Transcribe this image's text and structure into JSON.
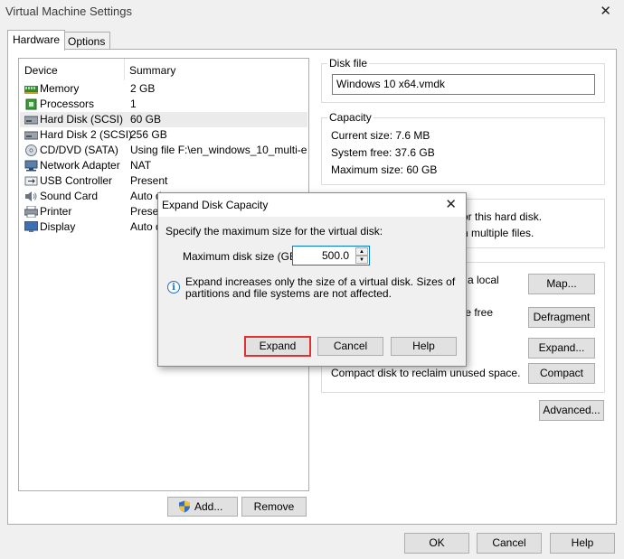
{
  "window": {
    "title": "Virtual Machine Settings",
    "close_glyph": "✕"
  },
  "tabs": [
    {
      "label": "Hardware"
    },
    {
      "label": "Options"
    }
  ],
  "device_list": {
    "headers": {
      "device": "Device",
      "summary": "Summary"
    },
    "rows": [
      {
        "name": "Memory",
        "summary": "2 GB",
        "icon": "memory-icon"
      },
      {
        "name": "Processors",
        "summary": "1",
        "icon": "processor-icon"
      },
      {
        "name": "Hard Disk (SCSI)",
        "summary": "60 GB",
        "icon": "hard-disk-icon",
        "selected": true
      },
      {
        "name": "Hard Disk 2 (SCSI)",
        "summary": "256 GB",
        "icon": "hard-disk-icon"
      },
      {
        "name": "CD/DVD (SATA)",
        "summary": "Using file F:\\en_windows_10_multi-e...",
        "icon": "cd-dvd-icon"
      },
      {
        "name": "Network Adapter",
        "summary": "NAT",
        "icon": "network-adapter-icon"
      },
      {
        "name": "USB Controller",
        "summary": "Present",
        "icon": "usb-icon"
      },
      {
        "name": "Sound Card",
        "summary": "Auto d",
        "icon": "speaker-icon"
      },
      {
        "name": "Printer",
        "summary": "Presen",
        "icon": "printer-icon"
      },
      {
        "name": "Display",
        "summary": "Auto d",
        "icon": "display-icon"
      }
    ],
    "add_label": "Add...",
    "remove_label": "Remove"
  },
  "disk_file": {
    "title": "Disk file",
    "value": "Windows 10 x64.vmdk"
  },
  "capacity": {
    "title": "Capacity",
    "current": "Current size:  7.6 MB",
    "free": "System free:  37.6 GB",
    "max": "Maximum size:  60 GB"
  },
  "disk_info": {
    "line1": "or this hard disk.",
    "line2": "n multiple files."
  },
  "utilities": {
    "map_text": "a local",
    "map_label": "Map...",
    "defrag_text": "te free",
    "defrag_label": "Defragment",
    "expand_label": "Expand...",
    "compact_text": "Compact disk to reclaim unused space.",
    "compact_label": "Compact"
  },
  "advanced_label": "Advanced...",
  "footer": {
    "ok": "OK",
    "cancel": "Cancel",
    "help": "Help"
  },
  "dialog": {
    "title": "Expand Disk Capacity",
    "close_glyph": "✕",
    "prompt": "Specify the maximum size for the virtual disk:",
    "size_label": "Maximum disk size (GB):",
    "size_value": "500.0",
    "info_line1": "Expand increases only the size of a virtual disk. Sizes of",
    "info_line2": "partitions and file systems are not affected.",
    "expand_label": "Expand",
    "cancel_label": "Cancel",
    "help_label": "Help"
  }
}
